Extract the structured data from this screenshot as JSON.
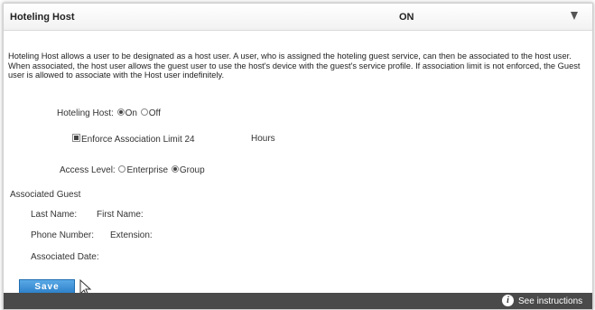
{
  "header": {
    "title": "Hoteling Host",
    "status": "ON",
    "toggle_icon": "chevron-down-icon"
  },
  "description": "Hoteling Host allows a user to be designated as a host user. A user, who is assigned the hoteling guest service, can then be associated to the host user. When associated, the host user allows the guest user to use the host's device with the guest's service profile. If association limit is not enforced, the Guest user is allowed to associate with the Host user indefinitely.",
  "form": {
    "hoteling_host_label": "Hoteling Host:",
    "on_label": "On",
    "off_label": "Off",
    "hoteling_host_value": "On",
    "enforce_label": "Enforce Association Limit",
    "enforce_checked": true,
    "limit_value": "24",
    "hours_label": "Hours",
    "access_level_label": "Access Level:",
    "enterprise_label": "Enterprise",
    "group_label": "Group",
    "access_level_value": "Group"
  },
  "associated_guest": {
    "heading": "Associated Guest",
    "last_name_label": "Last Name:",
    "first_name_label": "First Name:",
    "phone_label": "Phone Number:",
    "extension_label": "Extension:",
    "date_label": "Associated Date:"
  },
  "actions": {
    "save_label": "Save"
  },
  "footer": {
    "see_instructions": "See instructions",
    "info_icon": "info-icon"
  }
}
